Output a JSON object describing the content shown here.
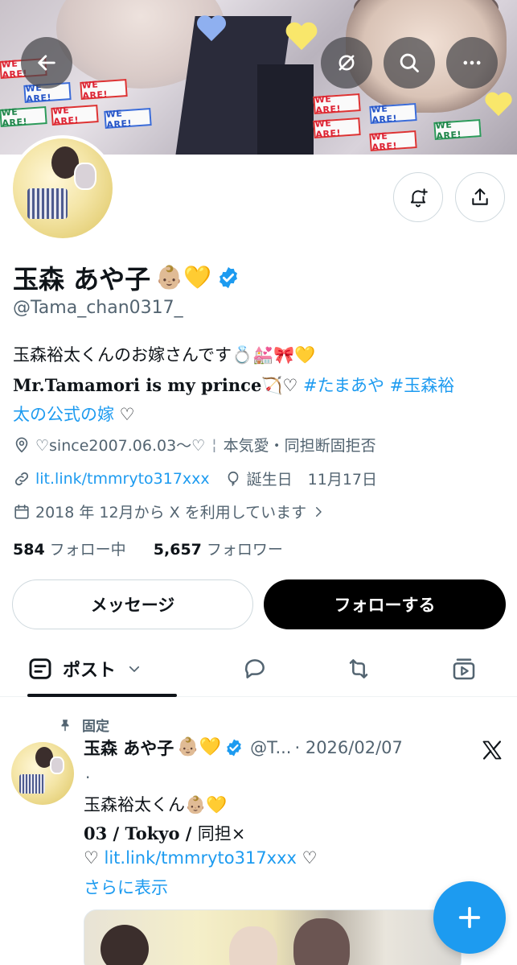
{
  "banner": {
    "sticker_text": "WE ARE!"
  },
  "profile": {
    "name": "玉森 あや子",
    "name_emojis": "👶🏼💛",
    "handle": "@Tama_chan0317_",
    "bio_line1": "玉森裕太くんのお嫁さんです💍💒🎀💛",
    "bio_line2_serif": "Mr.Tamamori is my prince",
    "bio_line2_emoji": "🏹♡",
    "bio_hashtag1": "#たまあや",
    "bio_hashtag2_part1": "#玉森裕",
    "bio_hashtag2_part2": "太の公式の嫁",
    "bio_tail": " ♡",
    "location": "♡since2007.06.03〜♡",
    "location_sep": "¦",
    "location_extra": "本気愛・同担断固拒否",
    "website": "lit.link/tmmryto317xxx",
    "birthday": "誕生日　11月17日",
    "joined": "2018 年 12月から X を利用しています",
    "following_count": "584",
    "following_label": "フォロー中",
    "followers_count": "5,657",
    "followers_label": "フォロワー"
  },
  "buttons": {
    "message": "メッセージ",
    "follow": "フォローする"
  },
  "tabs": {
    "posts": "ポスト"
  },
  "post": {
    "pinned_label": "固定",
    "author_name": "玉森 あや子",
    "author_emojis": "👶🏼💛",
    "author_handle": "@T...",
    "date": "· 2026/02/07",
    "dot": "·",
    "line1": "玉森裕太くん👶🏼💛",
    "line2_serif": "03 / Tokyo / ",
    "line2_rest": "同担×",
    "line3_prefix": "♡ ",
    "line3_link": "lit.link/tmmryto317xxx",
    "line3_suffix": " ♡",
    "show_more": "さらに表示"
  },
  "colors": {
    "accent": "#1d9bf0",
    "text": "#0f1419",
    "muted": "#536471"
  }
}
